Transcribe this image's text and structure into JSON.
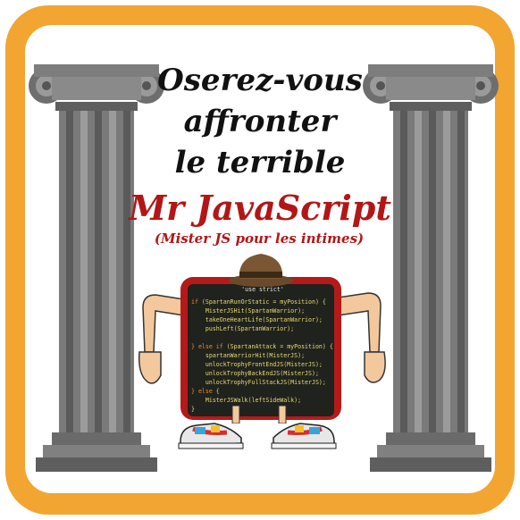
{
  "colors": {
    "border": "#f2a530",
    "card": "#ffffff",
    "title": "#111111",
    "accent_red": "#b21616",
    "column_gray": "#7a7a7a",
    "monitor_red": "#b51a1a",
    "screen_bg": "#20221d"
  },
  "headline": {
    "line1": "Oserez-vous",
    "line2": "affronter",
    "line3": "le terrible",
    "name": "Mr JavaScript",
    "subtitle": "(Mister JS pour les intimes)"
  },
  "code": {
    "header": "'use strict'",
    "lines": [
      {
        "kw": "if ",
        "text": "(SpartanRunOrStatic = myPosition) {"
      },
      {
        "kw": "",
        "text": "    MisterJSHit(SpartanWarrior);"
      },
      {
        "kw": "",
        "text": "    takeOneHeartLife(SpartanWarrior);"
      },
      {
        "kw": "",
        "text": "    pushLeft(SpartanWarrior);"
      },
      {
        "kw": "",
        "text": ""
      },
      {
        "kw": "} else if ",
        "text": "(SpartanAttack = myPosition) {"
      },
      {
        "kw": "",
        "text": "    spartanWarriorHit(MisterJS);"
      },
      {
        "kw": "",
        "text": "    unlockTrophyFrontEndJS(MisterJS);"
      },
      {
        "kw": "",
        "text": "    unlockTrophyBackEndJS(MisterJS);"
      },
      {
        "kw": "",
        "text": "    unlockTrophyFullStackJS(MisterJS);"
      },
      {
        "kw": "} else ",
        "text": "{"
      },
      {
        "kw": "",
        "text": "    MisterJSWalk(leftSideWalk);"
      },
      {
        "kw": "",
        "text": "}"
      }
    ]
  },
  "icons": {
    "left_column": "ionic-column-icon",
    "right_column": "ionic-column-icon",
    "hat": "fedora-hat-icon",
    "shoes": "sneaker-icon"
  }
}
